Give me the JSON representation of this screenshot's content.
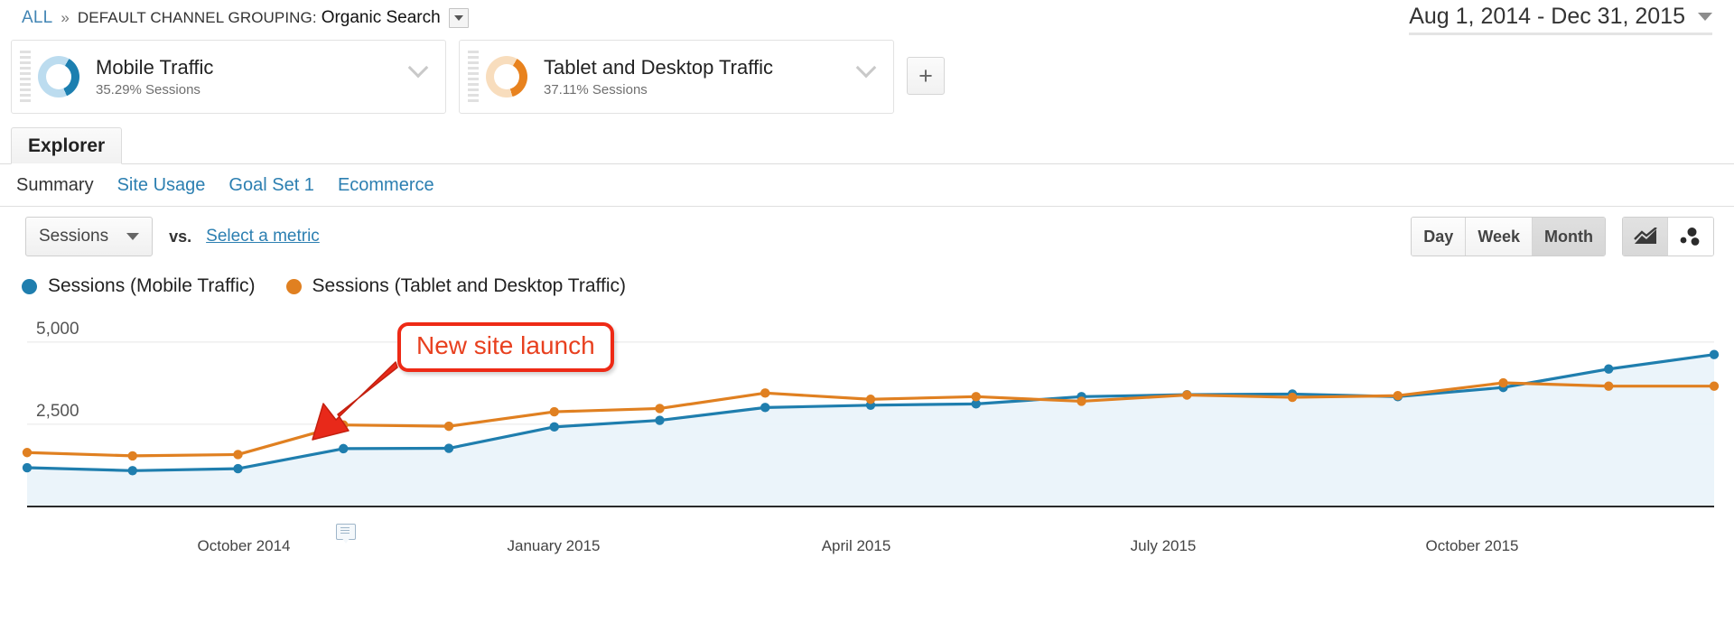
{
  "breadcrumb": {
    "root": "ALL",
    "separator": "»",
    "dimension_label": "DEFAULT CHANNEL GROUPING:",
    "dimension_value": "Organic Search",
    "caret_icon": "caret-down-icon"
  },
  "date_range": {
    "label": "Aug 1, 2014 - Dec 31, 2015",
    "caret_icon": "caret-down-icon"
  },
  "segments": [
    {
      "name": "Mobile Traffic",
      "stat": "35.29% Sessions",
      "color": "#1c7fb0",
      "track_color": "#bcdcef",
      "percent": 35.29,
      "grip_icon": "drag-handle-icon",
      "chevron_icon": "chevron-down-icon"
    },
    {
      "name": "Tablet and Desktop Traffic",
      "stat": "37.11% Sessions",
      "color": "#e8821e",
      "track_color": "#f8ddbd",
      "percent": 37.11,
      "grip_icon": "drag-handle-icon",
      "chevron_icon": "chevron-down-icon"
    }
  ],
  "add_segment": {
    "label": "+",
    "icon": "plus-icon"
  },
  "tabs": [
    {
      "label": "Explorer",
      "active": true
    }
  ],
  "subnav": [
    {
      "label": "Summary",
      "active": true
    },
    {
      "label": "Site Usage",
      "active": false
    },
    {
      "label": "Goal Set 1",
      "active": false
    },
    {
      "label": "Ecommerce",
      "active": false
    }
  ],
  "metric_toolbar": {
    "primary_metric": "Sessions",
    "primary_caret_icon": "caret-down-icon",
    "vs_label": "vs.",
    "secondary_metric": "Select a metric",
    "granularity": [
      {
        "label": "Day",
        "selected": false
      },
      {
        "label": "Week",
        "selected": false
      },
      {
        "label": "Month",
        "selected": true
      }
    ],
    "chart_type_buttons": [
      {
        "icon": "line-chart-icon",
        "selected": true
      },
      {
        "icon": "motion-chart-icon",
        "selected": false
      }
    ]
  },
  "annotation": {
    "text": "New site launch",
    "border_color": "#ee2a16",
    "text_color": "#e8401f",
    "arrow_color": "#e8291a",
    "arrow_icon": "arrow-pointer-icon"
  },
  "chart_data": {
    "type": "line",
    "title": "",
    "xlabel": "",
    "ylabel": "",
    "ylim": [
      0,
      5600
    ],
    "yticks": [
      2500,
      5000
    ],
    "ytick_labels": [
      "2,500",
      "5,000"
    ],
    "grid": true,
    "legend_position": "top-left",
    "x": [
      "Aug 2014",
      "Sep 2014",
      "Oct 2014",
      "Nov 2014",
      "Dec 2014",
      "Jan 2015",
      "Feb 2015",
      "Mar 2015",
      "Apr 2015",
      "May 2015",
      "Jun 2015",
      "Jul 2015",
      "Aug 2015",
      "Sep 2015",
      "Oct 2015",
      "Nov 2015",
      "Dec 2015"
    ],
    "xtick_labels": [
      "October 2014",
      "January 2015",
      "April 2015",
      "July 2015",
      "October 2015"
    ],
    "series": [
      {
        "name": "Sessions (Mobile Traffic)",
        "color": "#1f7eae",
        "fill": "#eaf3fa",
        "values": [
          1180,
          1090,
          1150,
          1760,
          1770,
          2420,
          2620,
          3010,
          3080,
          3120,
          3340,
          3400,
          3420,
          3340,
          3620,
          4180,
          4620
        ]
      },
      {
        "name": "Sessions (Tablet and Desktop Traffic)",
        "color": "#e08021",
        "values": [
          1640,
          1540,
          1580,
          2480,
          2440,
          2880,
          2980,
          3450,
          3260,
          3340,
          3200,
          3390,
          3320,
          3370,
          3760,
          3660,
          3660
        ]
      }
    ],
    "annotation_marker_x": "Nov 2014"
  }
}
